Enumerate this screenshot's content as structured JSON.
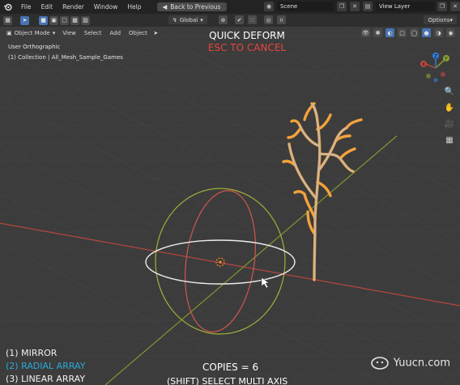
{
  "menu": {
    "items": [
      "File",
      "Edit",
      "Render",
      "Window",
      "Help"
    ],
    "back_button": "Back to Previous",
    "scene": "Scene",
    "view_layer": "View Layer"
  },
  "toolbar": {
    "orientation": "Global",
    "options": "Options"
  },
  "header": {
    "mode": "Object Mode",
    "items": [
      "View",
      "Select",
      "Add",
      "Object"
    ]
  },
  "viewport": {
    "view_name": "User Orthographic",
    "collection": "(1) Collection | All_Mesh_Sample_Games"
  },
  "overlay": {
    "title": "QUICK DEFORM",
    "subtitle": "ESC TO CANCEL",
    "options": [
      {
        "label": "(1) MIRROR",
        "color": "#f2f2f2"
      },
      {
        "label": "(2) RADIAL ARRAY",
        "color": "#29a9d8"
      },
      {
        "label": "(3) LINEAR ARRAY",
        "color": "#f2f2f2"
      }
    ],
    "copies": "COPIES = 6",
    "shift_hint": "(SHIFT) SELECT MULTI AXIS"
  },
  "gizmo": {
    "x": "X",
    "y": "Y",
    "z": "Z"
  },
  "watermark": "Yuucn.com",
  "colors": {
    "x_axis": "#c04a44",
    "y_axis": "#8aa132",
    "selection": "#f4a23c",
    "accent": "#4772b3"
  }
}
